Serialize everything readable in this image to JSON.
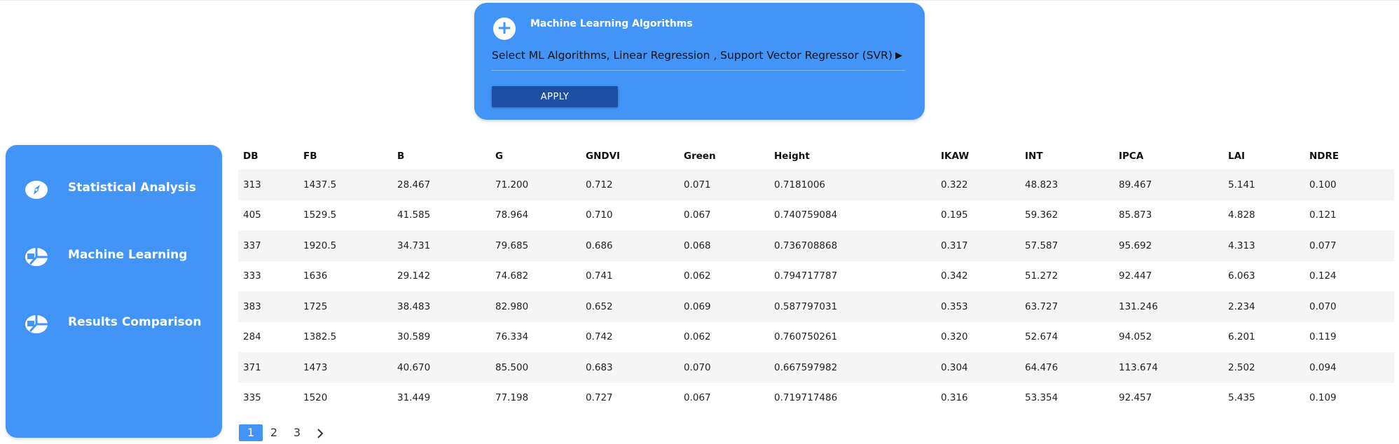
{
  "ml_panel": {
    "title": "Machine Learning Algorithms",
    "select_value": "Select ML Algorithms,  Linear Regression ,  Support Vector Regressor (SVR)",
    "apply_label": "APPLY",
    "plus_icon": "plus-circle-icon"
  },
  "sidebar": {
    "items": [
      {
        "label": "Statistical Analysis",
        "icon": "compass-icon"
      },
      {
        "label": "Machine Learning",
        "icon": "pie-chart-icon"
      },
      {
        "label": "Results Comparison",
        "icon": "pie-chart-icon"
      }
    ]
  },
  "table": {
    "headers": [
      "DB",
      "FB",
      "B",
      "G",
      "GNDVI",
      "Green",
      "Height",
      "IKAW",
      "INT",
      "IPCA",
      "LAI",
      "NDRE"
    ],
    "rows": [
      [
        "313",
        "1437.5",
        "28.467",
        "71.200",
        "0.712",
        "0.071",
        "0.7181006",
        "0.322",
        "48.823",
        "89.467",
        "5.141",
        "0.100"
      ],
      [
        "405",
        "1529.5",
        "41.585",
        "78.964",
        "0.710",
        "0.067",
        "0.740759084",
        "0.195",
        "59.362",
        "85.873",
        "4.828",
        "0.121"
      ],
      [
        "337",
        "1920.5",
        "34.731",
        "79.685",
        "0.686",
        "0.068",
        "0.736708868",
        "0.317",
        "57.587",
        "95.692",
        "4.313",
        "0.077"
      ],
      [
        "333",
        "1636",
        "29.142",
        "74.682",
        "0.741",
        "0.062",
        "0.794717787",
        "0.342",
        "51.272",
        "92.447",
        "6.063",
        "0.124"
      ],
      [
        "383",
        "1725",
        "38.483",
        "82.980",
        "0.652",
        "0.069",
        "0.587797031",
        "0.353",
        "63.727",
        "131.246",
        "2.234",
        "0.070"
      ],
      [
        "284",
        "1382.5",
        "30.589",
        "76.334",
        "0.742",
        "0.062",
        "0.760750261",
        "0.320",
        "52.674",
        "94.052",
        "6.201",
        "0.119"
      ],
      [
        "371",
        "1473",
        "40.670",
        "85.500",
        "0.683",
        "0.070",
        "0.667597982",
        "0.304",
        "64.476",
        "113.674",
        "2.502",
        "0.094"
      ],
      [
        "335",
        "1520",
        "31.449",
        "77.198",
        "0.727",
        "0.067",
        "0.719717486",
        "0.316",
        "53.354",
        "92.457",
        "5.435",
        "0.109"
      ]
    ]
  },
  "pagination": {
    "pages": [
      "1",
      "2",
      "3"
    ],
    "active": "1",
    "next_icon": "chevron-right-icon"
  },
  "colors": {
    "accent": "#4295f7",
    "button_dark": "#1f4fa3"
  }
}
